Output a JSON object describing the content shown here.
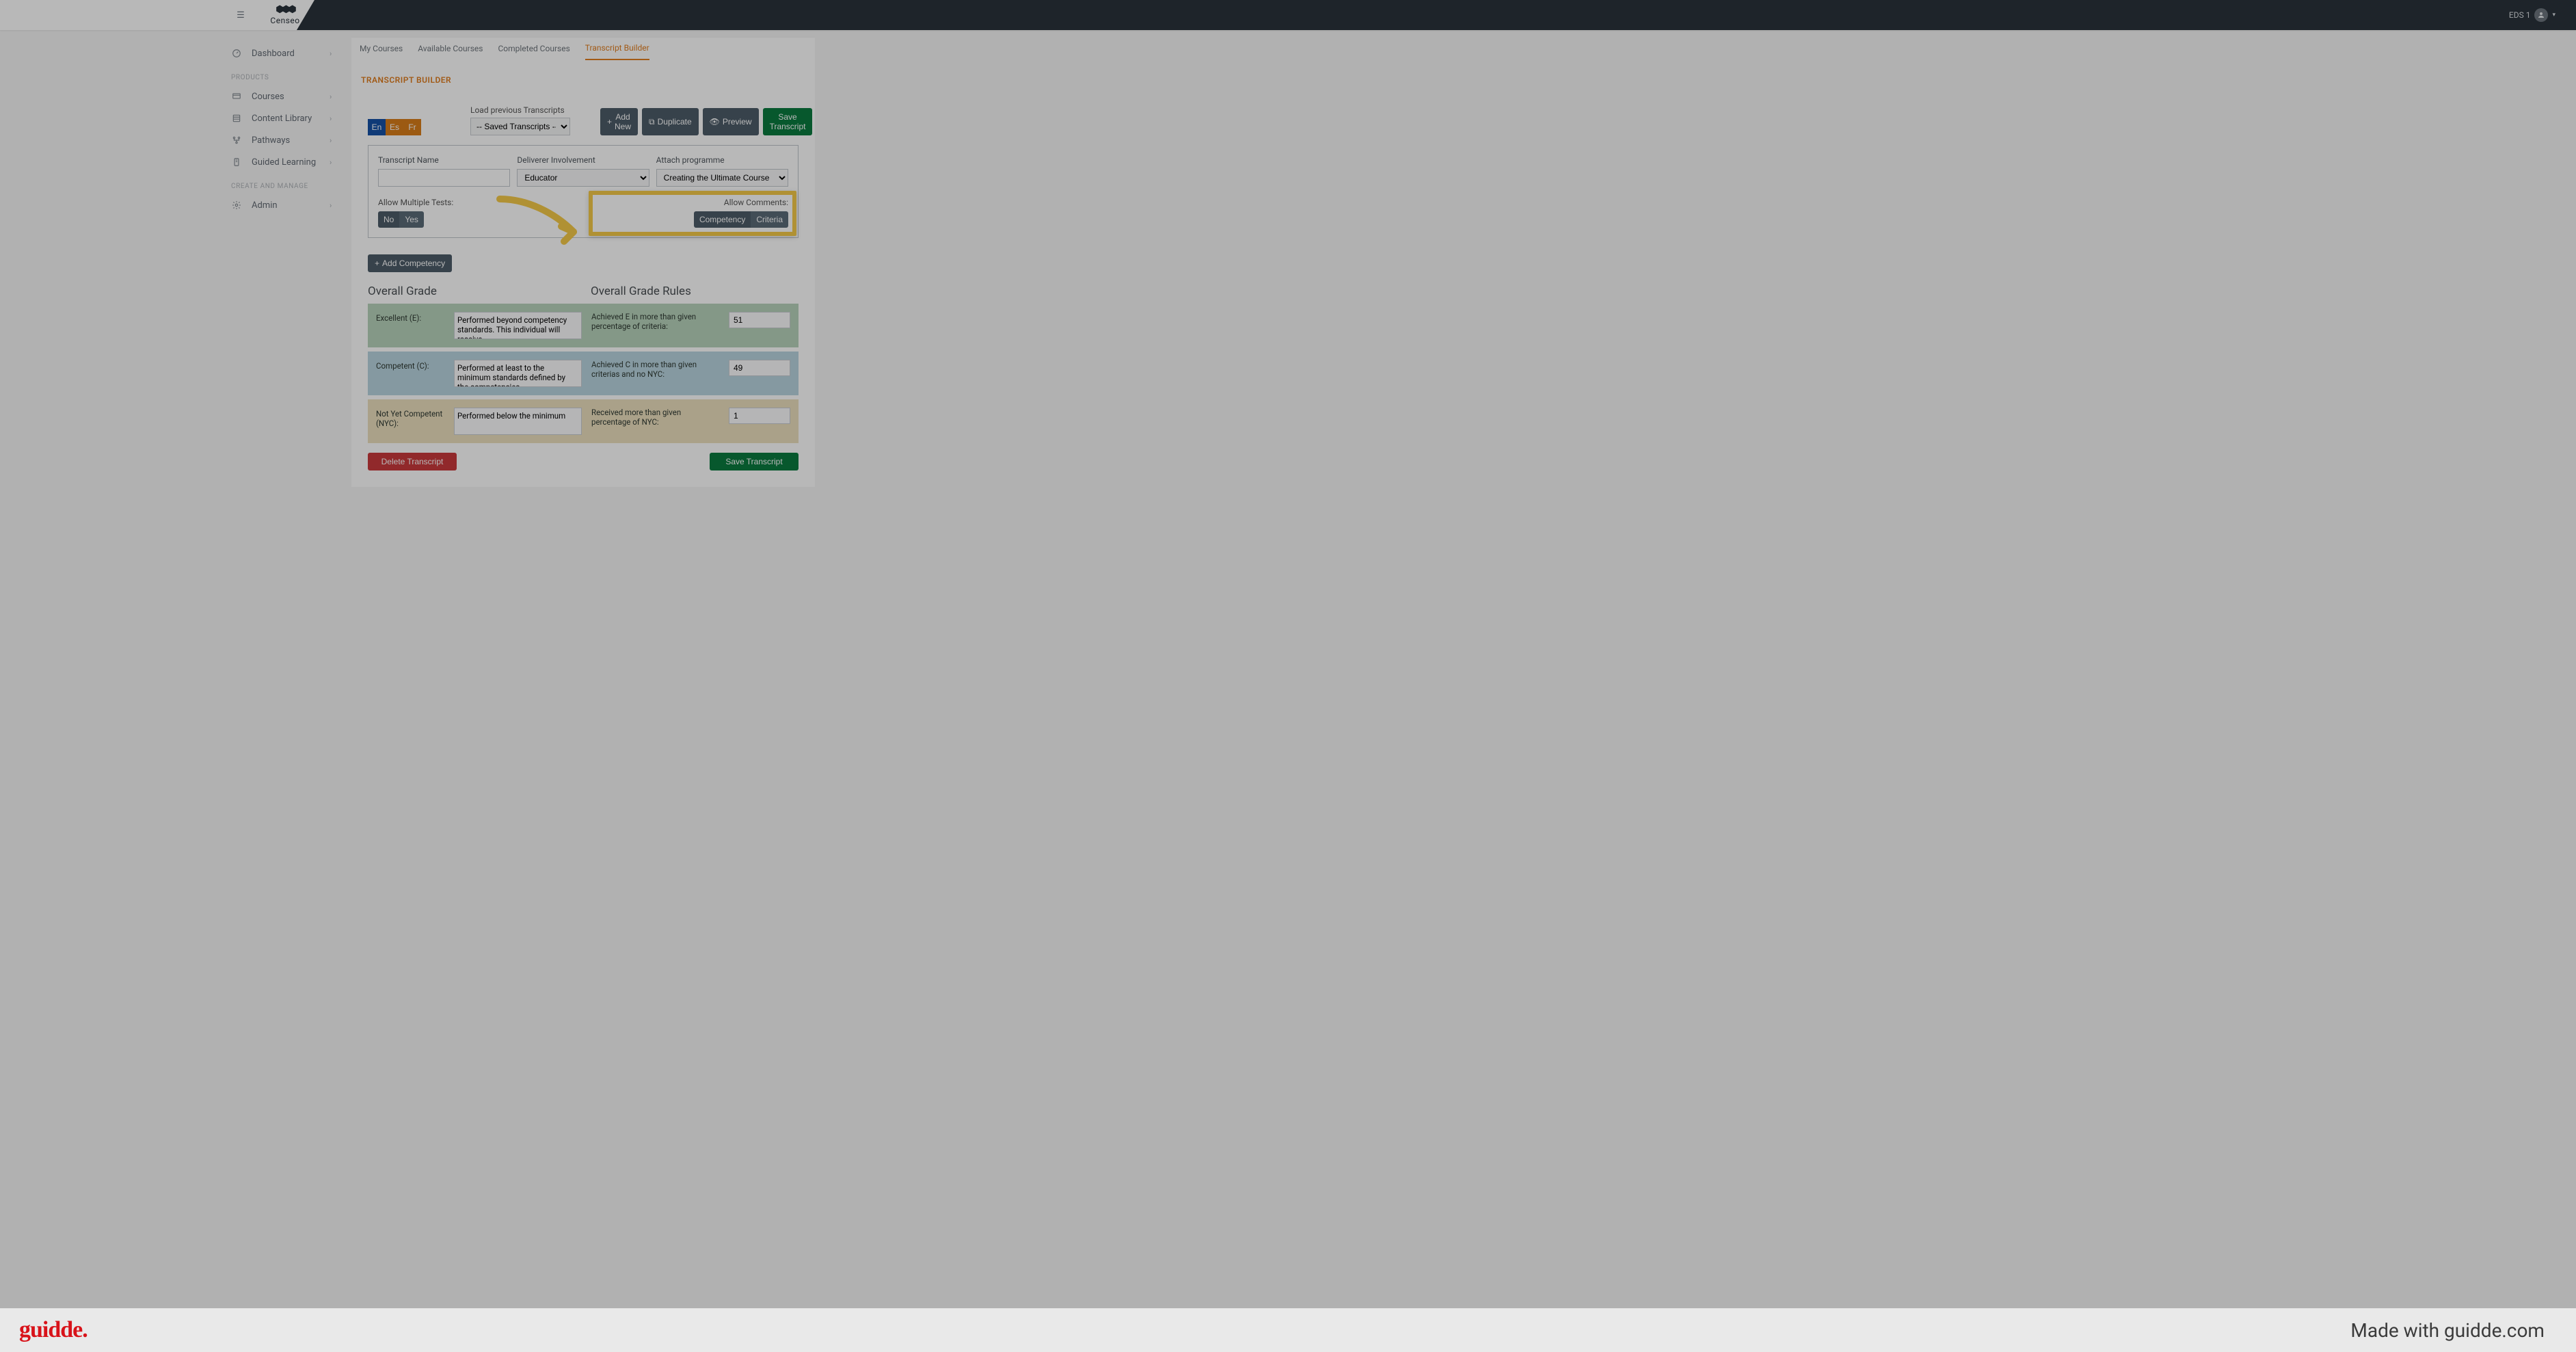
{
  "topbar": {
    "logo_text": "Censeo",
    "user_name": "EDS 1"
  },
  "sidebar": {
    "dashboard": "Dashboard",
    "group_products": "PRODUCTS",
    "courses": "Courses",
    "content_library": "Content Library",
    "pathways": "Pathways",
    "guided_learning": "Guided Learning",
    "group_create": "CREATE AND MANAGE",
    "admin": "Admin"
  },
  "tabs": {
    "my_courses": "My Courses",
    "available": "Available Courses",
    "completed": "Completed Courses",
    "builder": "Transcript Builder"
  },
  "page_title": "TRANSCRIPT BUILDER",
  "lang": {
    "en": "En",
    "es": "Es",
    "fr": "Fr"
  },
  "saved": {
    "label": "Load previous Transcripts",
    "option": "-- Saved Transcripts --"
  },
  "top_buttons": {
    "add_new": "Add New",
    "duplicate": "Duplicate",
    "preview": "Preview",
    "save": "Save Transcript"
  },
  "form": {
    "name_label": "Transcript Name",
    "name_value": "",
    "deliverer_label": "Deliverer Involvement",
    "deliverer_value": "Educator",
    "programme_label": "Attach programme",
    "programme_value": "Creating the Ultimate Course",
    "allow_multi_label": "Allow Multiple Tests:",
    "multi_no": "No",
    "multi_yes": "Yes",
    "allow_comments_label": "Allow Comments:",
    "comments_competency": "Competency",
    "comments_criteria": "Criteria"
  },
  "add_competency": "Add Competency",
  "grades": {
    "overall_title": "Overall Grade",
    "rules_title": "Overall Grade Rules",
    "excellent_label": "Excellent (E):",
    "excellent_text": "Performed beyond competency standards. This individual will receive",
    "excellent_rule": "Achieved E in more than given percentage of criteria:",
    "excellent_val": "51",
    "competent_label": "Competent (C):",
    "competent_text": "Performed at least to the minimum standards defined by the competencies",
    "competent_rule": "Achieved C in more than given criterias and no NYC:",
    "competent_val": "49",
    "nyc_label": "Not Yet Competent (NYC):",
    "nyc_text": "Performed below the minimum",
    "nyc_rule": "Received more than given percentage of NYC:",
    "nyc_val": "1"
  },
  "footer": {
    "delete": "Delete Transcript",
    "save": "Save Transcript"
  },
  "guidde": {
    "logo": "guidde.",
    "right": "Made with guidde.com"
  }
}
